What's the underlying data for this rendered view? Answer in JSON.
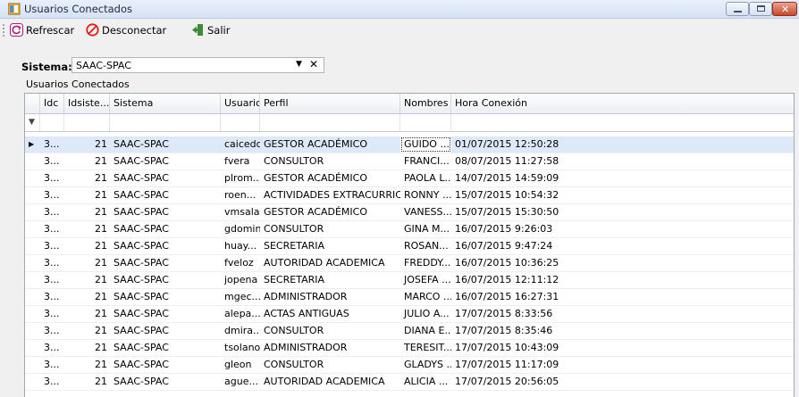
{
  "window": {
    "title": "Usuarios Conectados"
  },
  "toolbar": {
    "refresh": "Refrescar",
    "disconnect": "Desconectar",
    "exit": "Salir"
  },
  "filter": {
    "label": "Sistema:",
    "value": "SAAC-SPAC"
  },
  "grid": {
    "caption": "Usuarios Conectados",
    "columns": [
      "Idc",
      "Idsiste...",
      "Sistema",
      "Usuario",
      "Perfil",
      "Nombres",
      "Hora Conexión"
    ],
    "selected_row": 0,
    "rows": [
      [
        "3...",
        "21",
        "SAAC-SPAC",
        "caicedo",
        "GESTOR ACADÉMICO",
        "GUIDO ...",
        "01/07/2015 12:50:28"
      ],
      [
        "3...",
        "21",
        "SAAC-SPAC",
        "fvera",
        "CONSULTOR",
        "FRANCI...",
        "08/07/2015 11:27:58"
      ],
      [
        "3...",
        "21",
        "SAAC-SPAC",
        "plrom...",
        "GESTOR ACADÉMICO",
        "PAOLA L...",
        "14/07/2015 14:59:09"
      ],
      [
        "3...",
        "21",
        "SAAC-SPAC",
        "roen...",
        "ACTIVIDADES EXTRACURRIC...",
        "RONNY ...",
        "15/07/2015 10:54:32"
      ],
      [
        "3...",
        "21",
        "SAAC-SPAC",
        "vmsalaz",
        "GESTOR ACADÉMICO",
        "VANESS...",
        "15/07/2015 15:30:50"
      ],
      [
        "3...",
        "21",
        "SAAC-SPAC",
        "gdomin",
        "CONSULTOR",
        "GINA M...",
        "16/07/2015 9:26:03"
      ],
      [
        "3...",
        "21",
        "SAAC-SPAC",
        "huay...",
        "SECRETARIA",
        "ROSAN...",
        "16/07/2015 9:47:24"
      ],
      [
        "3...",
        "21",
        "SAAC-SPAC",
        "fveloz",
        "AUTORIDAD ACADEMICA",
        "FREDDY...",
        "16/07/2015 10:36:25"
      ],
      [
        "3...",
        "21",
        "SAAC-SPAC",
        "jopena",
        "SECRETARIA",
        "JOSEFA ...",
        "16/07/2015 12:11:12"
      ],
      [
        "3...",
        "21",
        "SAAC-SPAC",
        "mgec...",
        "ADMINISTRADOR",
        "MARCO ...",
        "16/07/2015 16:27:31"
      ],
      [
        "3...",
        "21",
        "SAAC-SPAC",
        "alepa...",
        "ACTAS ANTIGUAS",
        "JULIO A...",
        "17/07/2015 8:33:56"
      ],
      [
        "3...",
        "21",
        "SAAC-SPAC",
        "dmira...",
        "CONSULTOR",
        "DIANA E...",
        "17/07/2015 8:35:46"
      ],
      [
        "3...",
        "21",
        "SAAC-SPAC",
        "tsolano",
        "ADMINISTRADOR",
        "TERESIT...",
        "17/07/2015 10:43:09"
      ],
      [
        "3...",
        "21",
        "SAAC-SPAC",
        "gleon",
        "CONSULTOR",
        "GLADYS ...",
        "17/07/2015 11:17:09"
      ],
      [
        "3...",
        "21",
        "SAAC-SPAC",
        "ague...",
        "AUTORIDAD ACADEMICA",
        "ALICIA ...",
        "17/07/2015 20:56:05"
      ]
    ]
  }
}
